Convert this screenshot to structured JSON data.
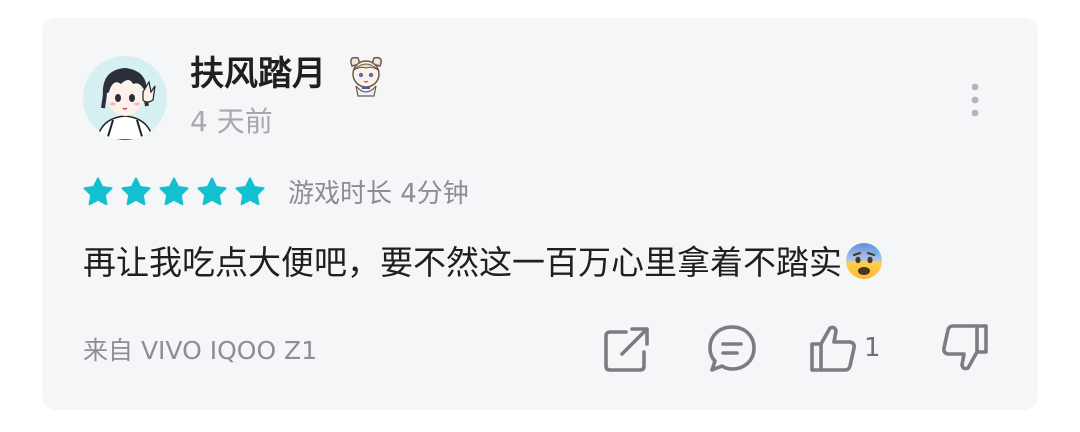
{
  "user": {
    "name": "扶风踏月",
    "time_ago": "4 天前"
  },
  "review": {
    "rating": 5,
    "rating_max": 5,
    "playtime": "游戏时长 4分钟",
    "text": "再让我吃点大便吧，要不然这一百万心里拿着不踏实",
    "emoji": "anxious-face-with-sweat-emoji",
    "device": "来自 VIVO IQOO Z1",
    "like_count": "1"
  },
  "icons": {
    "more": "more-vertical-icon",
    "share": "share-icon",
    "comment": "comment-icon",
    "like": "thumbs-up-icon",
    "dislike": "thumbs-down-icon",
    "star": "star-icon",
    "badge": "character-badge-icon"
  },
  "colors": {
    "star": "#13c0cf",
    "card_background": "#f5f6f8",
    "text_primary": "#1f1f1f",
    "text_secondary": "#8c8e93",
    "icon_gray": "#7b7d82"
  }
}
